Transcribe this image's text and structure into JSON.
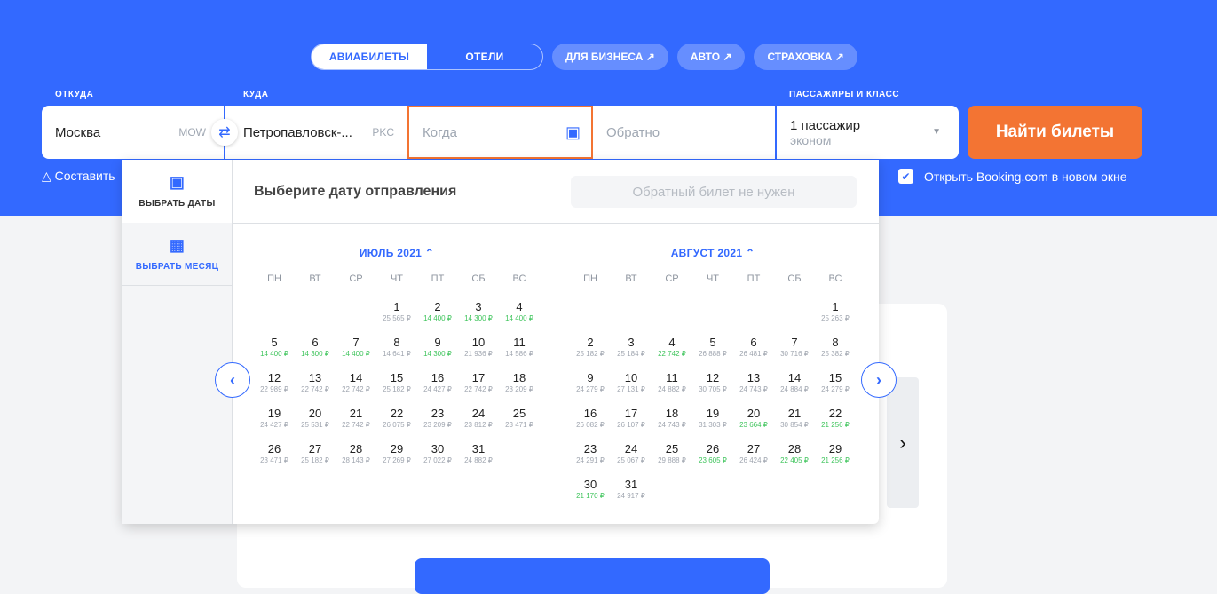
{
  "tabs": {
    "flights": "АВИАБИЛЕТЫ",
    "hotels": "ОТЕЛИ",
    "business": "ДЛЯ БИЗНЕСА ↗",
    "auto": "АВТО ↗",
    "insurance": "СТРАХОВКА ↗"
  },
  "search": {
    "from_label": "ОТКУДА",
    "from_value": "Москва",
    "from_code": "MOW",
    "to_label": "КУДА",
    "to_value": "Петропавловск-...",
    "to_code": "PKC",
    "depart_placeholder": "Когда",
    "return_placeholder": "Обратно",
    "pax_label": "ПАССАЖИРЫ И КЛАСС",
    "pax_value": "1 пассажир",
    "class_value": "эконом",
    "find_button": "Найти билеты",
    "compose_route": "Составить",
    "booking_checkbox": "Открыть Booking.com в новом окне"
  },
  "picker": {
    "mode_dates": "ВЫБРАТЬ ДАТЫ",
    "mode_month": "ВЫБРАТЬ МЕСЯЦ",
    "title": "Выберите дату отправления",
    "no_return": "Обратный билет не нужен",
    "weekdays": [
      "ПН",
      "ВТ",
      "СР",
      "ЧТ",
      "ПТ",
      "СБ",
      "ВС"
    ],
    "months": [
      {
        "name": "ИЮЛЬ 2021 ⌃",
        "offset": 3,
        "days": [
          [
            "25 565 ₽",
            0
          ],
          [
            "14 400 ₽",
            1
          ],
          [
            "14 300 ₽",
            1
          ],
          [
            "14 400 ₽",
            1
          ],
          [
            "14 400 ₽",
            1
          ],
          [
            "14 300 ₽",
            1
          ],
          [
            "14 400 ₽",
            1
          ],
          [
            "14 641 ₽",
            0
          ],
          [
            "14 300 ₽",
            1
          ],
          [
            "21 936 ₽",
            0
          ],
          [
            "14 586 ₽",
            0
          ],
          [
            "22 989 ₽",
            0
          ],
          [
            "22 742 ₽",
            0
          ],
          [
            "22 742 ₽",
            0
          ],
          [
            "25 182 ₽",
            0
          ],
          [
            "24 427 ₽",
            0
          ],
          [
            "22 742 ₽",
            0
          ],
          [
            "23 209 ₽",
            0
          ],
          [
            "24 427 ₽",
            0
          ],
          [
            "25 531 ₽",
            0
          ],
          [
            "22 742 ₽",
            0
          ],
          [
            "26 075 ₽",
            0
          ],
          [
            "23 209 ₽",
            0
          ],
          [
            "23 812 ₽",
            0
          ],
          [
            "23 471 ₽",
            0
          ],
          [
            "23 471 ₽",
            0
          ],
          [
            "25 182 ₽",
            0
          ],
          [
            "28 143 ₽",
            0
          ],
          [
            "27 269 ₽",
            0
          ],
          [
            "27 022 ₽",
            0
          ],
          [
            "24 882 ₽",
            0
          ]
        ]
      },
      {
        "name": "АВГУСТ 2021 ⌃",
        "offset": 6,
        "days": [
          [
            "25 263 ₽",
            0
          ],
          [
            "25 182 ₽",
            0
          ],
          [
            "25 184 ₽",
            0
          ],
          [
            "22 742 ₽",
            1
          ],
          [
            "26 888 ₽",
            0
          ],
          [
            "26 481 ₽",
            0
          ],
          [
            "30 716 ₽",
            0
          ],
          [
            "25 382 ₽",
            0
          ],
          [
            "24 279 ₽",
            0
          ],
          [
            "27 131 ₽",
            0
          ],
          [
            "24 882 ₽",
            0
          ],
          [
            "30 705 ₽",
            0
          ],
          [
            "24 743 ₽",
            0
          ],
          [
            "24 884 ₽",
            0
          ],
          [
            "24 279 ₽",
            0
          ],
          [
            "26 082 ₽",
            0
          ],
          [
            "26 107 ₽",
            0
          ],
          [
            "24 743 ₽",
            0
          ],
          [
            "31 303 ₽",
            0
          ],
          [
            "23 664 ₽",
            1
          ],
          [
            "30 854 ₽",
            0
          ],
          [
            "21 256 ₽",
            1
          ],
          [
            "24 291 ₽",
            0
          ],
          [
            "25 067 ₽",
            0
          ],
          [
            "29 888 ₽",
            0
          ],
          [
            "23 605 ₽",
            1
          ],
          [
            "26 424 ₽",
            0
          ],
          [
            "22 405 ₽",
            1
          ],
          [
            "21 256 ₽",
            1
          ],
          [
            "21 170 ₽",
            1
          ],
          [
            "24 917 ₽",
            0
          ]
        ]
      }
    ]
  },
  "colors": {
    "brand": "#3369ff",
    "accent": "#f37433",
    "low_price": "#3fc45c"
  }
}
